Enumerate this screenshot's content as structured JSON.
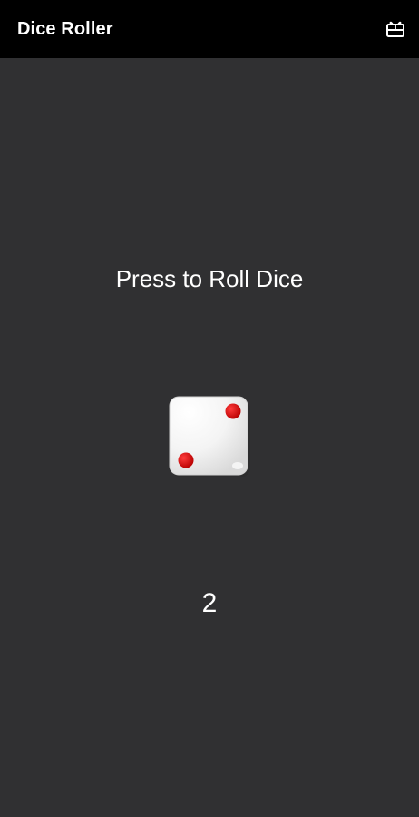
{
  "app_bar": {
    "title": "Dice Roller",
    "action_icon": "gift-card-icon"
  },
  "main": {
    "prompt": "Press to Roll Dice",
    "dice_face": 2,
    "result": "2"
  },
  "colors": {
    "background": "#303032",
    "app_bar": "#000000",
    "dice_body": "#f2f2f2",
    "dice_pip": "#d40000",
    "text": "#ffffff"
  }
}
